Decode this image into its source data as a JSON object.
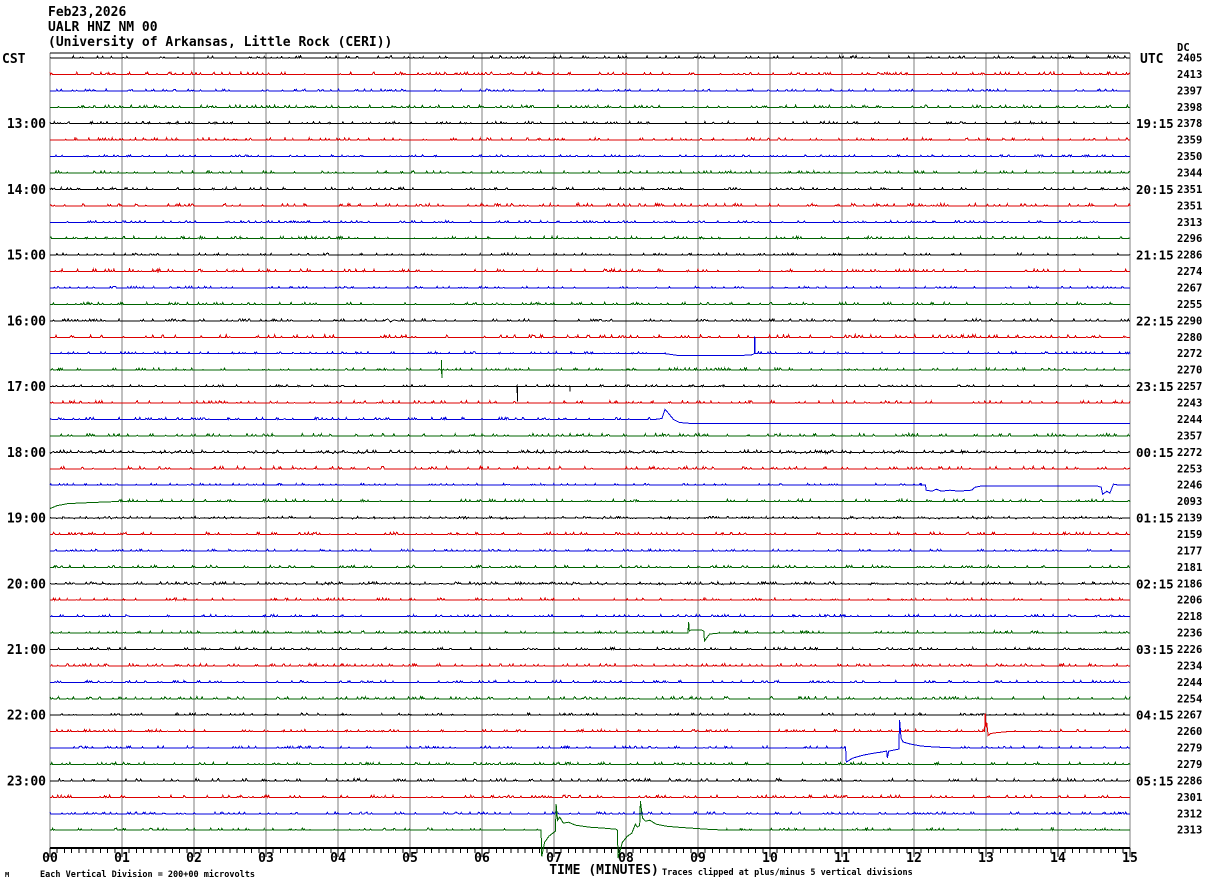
{
  "header": {
    "date": "Feb23,2026",
    "station": "UALR HNZ NM 00",
    "institution": "(University of Arkansas, Little Rock (CERI))"
  },
  "axes": {
    "left_tz": "CST",
    "right_tz": "UTC",
    "dc_header": "DC",
    "x_title": "TIME (MINUTES)",
    "x_ticks": [
      "00",
      "01",
      "02",
      "03",
      "04",
      "05",
      "06",
      "07",
      "08",
      "09",
      "10",
      "11",
      "12",
      "13",
      "14",
      "15"
    ]
  },
  "footer": {
    "scale_note": "Each Vertical Division =  200+00 microvolts",
    "clip_note": "Traces clipped at plus/minus 5 vertical divisions",
    "corner_mark": "M"
  },
  "palette": {
    "black": "#000000",
    "red": "#dd0000",
    "blue": "#0000dd",
    "green": "#006400",
    "grid": "#7f7f7f"
  },
  "chart_data": {
    "type": "line",
    "subtype": "helicorder-seismogram",
    "title": "UALR HNZ NM 00 (University of Arkansas, Little Rock (CERI)) Feb23,2026",
    "xlabel": "TIME (MINUTES)",
    "x_range_minutes": [
      0,
      15
    ],
    "minutes_per_line": 15,
    "grid": "vertical-only",
    "trace_color_cycle": [
      "black",
      "red",
      "blue",
      "green"
    ],
    "traces": [
      {
        "cst": "",
        "utc": "",
        "dc": "2405",
        "color": "black",
        "noise": 1.0,
        "events": []
      },
      {
        "cst": "",
        "utc": "",
        "dc": "2413",
        "color": "red",
        "noise": 1.0,
        "events": []
      },
      {
        "cst": "",
        "utc": "",
        "dc": "2397",
        "color": "blue",
        "noise": 0.7,
        "events": []
      },
      {
        "cst": "",
        "utc": "",
        "dc": "2398",
        "color": "green",
        "noise": 0.9,
        "events": []
      },
      {
        "cst": "13:00",
        "utc": "19:15",
        "dc": "2378",
        "color": "black",
        "noise": 0.9,
        "events": []
      },
      {
        "cst": "",
        "utc": "",
        "dc": "2359",
        "color": "red",
        "noise": 1.0,
        "events": []
      },
      {
        "cst": "",
        "utc": "",
        "dc": "2350",
        "color": "blue",
        "noise": 0.6,
        "events": []
      },
      {
        "cst": "",
        "utc": "",
        "dc": "2344",
        "color": "green",
        "noise": 0.9,
        "events": []
      },
      {
        "cst": "14:00",
        "utc": "20:15",
        "dc": "2351",
        "color": "black",
        "noise": 0.8,
        "events": []
      },
      {
        "cst": "",
        "utc": "",
        "dc": "2351",
        "color": "red",
        "noise": 1.0,
        "events": []
      },
      {
        "cst": "",
        "utc": "",
        "dc": "2313",
        "color": "blue",
        "noise": 0.6,
        "events": []
      },
      {
        "cst": "",
        "utc": "",
        "dc": "2296",
        "color": "green",
        "noise": 1.0,
        "events": []
      },
      {
        "cst": "15:00",
        "utc": "21:15",
        "dc": "2286",
        "color": "black",
        "noise": 0.8,
        "events": []
      },
      {
        "cst": "",
        "utc": "",
        "dc": "2274",
        "color": "red",
        "noise": 1.1,
        "events": []
      },
      {
        "cst": "",
        "utc": "",
        "dc": "2267",
        "color": "blue",
        "noise": 0.6,
        "events": []
      },
      {
        "cst": "",
        "utc": "",
        "dc": "2255",
        "color": "green",
        "noise": 0.9,
        "events": []
      },
      {
        "cst": "16:00",
        "utc": "22:15",
        "dc": "2290",
        "color": "black",
        "noise": 0.8,
        "events": [
          {
            "type": "path",
            "pts": [
              [
                4.64,
                0
              ],
              [
                4.69,
                2
              ],
              [
                4.73,
                -1
              ],
              [
                4.78,
                1
              ],
              [
                4.83,
                0
              ]
            ]
          }
        ]
      },
      {
        "cst": "",
        "utc": "",
        "dc": "2280",
        "color": "red",
        "noise": 1.1,
        "events": []
      },
      {
        "cst": "",
        "utc": "",
        "dc": "2272",
        "color": "blue",
        "noise": 0.9,
        "events": [
          {
            "type": "path",
            "pts": [
              [
                8.55,
                0
              ],
              [
                8.75,
                -2
              ],
              [
                9.55,
                -2
              ],
              [
                9.75,
                -1
              ],
              [
                9.78,
                0
              ]
            ]
          },
          {
            "type": "spike",
            "m": 9.79,
            "up": 17,
            "down": 0
          }
        ]
      },
      {
        "cst": "",
        "utc": "",
        "dc": "2270",
        "color": "green",
        "noise": 0.9,
        "events": [
          {
            "type": "spike",
            "m": 5.44,
            "up": 10,
            "down": 8
          }
        ]
      },
      {
        "cst": "17:00",
        "utc": "23:15",
        "dc": "2257",
        "color": "black",
        "noise": 0.7,
        "events": [
          {
            "type": "spike",
            "m": 6.49,
            "up": 0,
            "down": 15
          },
          {
            "type": "spike",
            "m": 7.22,
            "up": 0,
            "down": 5
          }
        ]
      },
      {
        "cst": "",
        "utc": "",
        "dc": "2243",
        "color": "red",
        "noise": 1.0,
        "events": []
      },
      {
        "cst": "",
        "utc": "",
        "dc": "2244",
        "color": "blue",
        "noise": 0.8,
        "events": [
          {
            "type": "path",
            "pts": [
              [
                8.4,
                0
              ],
              [
                8.5,
                1
              ],
              [
                8.54,
                10
              ],
              [
                8.58,
                7
              ],
              [
                8.66,
                0
              ],
              [
                8.74,
                -3
              ],
              [
                8.9,
                -4
              ],
              [
                15,
                -4
              ]
            ]
          }
        ]
      },
      {
        "cst": "",
        "utc": "",
        "dc": "2357",
        "color": "green",
        "noise": 1.0,
        "events": []
      },
      {
        "cst": "18:00",
        "utc": "00:15",
        "dc": "2272",
        "color": "black",
        "noise": 1.7,
        "events": []
      },
      {
        "cst": "",
        "utc": "",
        "dc": "2253",
        "color": "red",
        "noise": 1.0,
        "events": []
      },
      {
        "cst": "",
        "utc": "",
        "dc": "2246",
        "color": "blue",
        "noise": 0.7,
        "events": [
          {
            "type": "path",
            "pts": [
              [
                12.1,
                0
              ],
              [
                12.16,
                0
              ],
              [
                12.17,
                -5
              ],
              [
                12.25,
                -6
              ],
              [
                12.31,
                -4
              ],
              [
                12.38,
                -6
              ],
              [
                12.5,
                -5
              ],
              [
                12.62,
                -6
              ],
              [
                12.8,
                -5
              ],
              [
                12.85,
                -2
              ],
              [
                12.92,
                -1
              ],
              [
                14.55,
                -1
              ],
              [
                14.6,
                -2
              ],
              [
                14.62,
                -9
              ],
              [
                14.68,
                -6
              ],
              [
                14.72,
                -8
              ],
              [
                14.77,
                1
              ],
              [
                14.85,
                0
              ],
              [
                15,
                0
              ]
            ]
          }
        ]
      },
      {
        "cst": "",
        "utc": "",
        "dc": "2093",
        "color": "green",
        "noise": 1.0,
        "events": [
          {
            "type": "path",
            "pts": [
              [
                0,
                -7
              ],
              [
                0.1,
                -4
              ],
              [
                0.25,
                -2
              ],
              [
                0.55,
                -1
              ],
              [
                0.9,
                0
              ]
            ]
          }
        ]
      },
      {
        "cst": "19:00",
        "utc": "01:15",
        "dc": "2139",
        "color": "black",
        "noise": 1.3,
        "events": []
      },
      {
        "cst": "",
        "utc": "",
        "dc": "2159",
        "color": "red",
        "noise": 0.9,
        "events": []
      },
      {
        "cst": "",
        "utc": "",
        "dc": "2177",
        "color": "blue",
        "noise": 0.6,
        "events": []
      },
      {
        "cst": "",
        "utc": "",
        "dc": "2181",
        "color": "green",
        "noise": 0.8,
        "events": []
      },
      {
        "cst": "20:00",
        "utc": "02:15",
        "dc": "2186",
        "color": "black",
        "noise": 1.5,
        "events": []
      },
      {
        "cst": "",
        "utc": "",
        "dc": "2206",
        "color": "red",
        "noise": 0.9,
        "events": []
      },
      {
        "cst": "",
        "utc": "",
        "dc": "2218",
        "color": "blue",
        "noise": 0.8,
        "events": []
      },
      {
        "cst": "",
        "utc": "",
        "dc": "2236",
        "color": "green",
        "noise": 0.9,
        "events": [
          {
            "type": "path",
            "pts": [
              [
                8.84,
                0
              ],
              [
                8.86,
                0
              ],
              [
                8.87,
                11
              ],
              [
                8.88,
                2
              ],
              [
                8.9,
                3
              ],
              [
                9.05,
                3
              ],
              [
                9.08,
                2
              ],
              [
                9.09,
                -8
              ],
              [
                9.12,
                -5
              ],
              [
                9.16,
                -1
              ],
              [
                9.3,
                0
              ]
            ]
          }
        ]
      },
      {
        "cst": "21:00",
        "utc": "03:15",
        "dc": "2226",
        "color": "black",
        "noise": 0.8,
        "events": []
      },
      {
        "cst": "",
        "utc": "",
        "dc": "2234",
        "color": "red",
        "noise": 0.9,
        "events": []
      },
      {
        "cst": "",
        "utc": "",
        "dc": "2244",
        "color": "blue",
        "noise": 0.7,
        "events": []
      },
      {
        "cst": "",
        "utc": "",
        "dc": "2254",
        "color": "green",
        "noise": 0.9,
        "events": []
      },
      {
        "cst": "22:00",
        "utc": "04:15",
        "dc": "2267",
        "color": "black",
        "noise": 0.8,
        "events": []
      },
      {
        "cst": "",
        "utc": "",
        "dc": "2260",
        "color": "red",
        "noise": 0.9,
        "events": [
          {
            "type": "path",
            "pts": [
              [
                12.95,
                0
              ],
              [
                12.98,
                0
              ],
              [
                12.99,
                18
              ],
              [
                13.0,
                4
              ],
              [
                13.01,
                9
              ],
              [
                13.03,
                -4
              ],
              [
                13.06,
                -2
              ],
              [
                13.15,
                -1
              ],
              [
                13.3,
                0
              ]
            ]
          }
        ]
      },
      {
        "cst": "",
        "utc": "",
        "dc": "2279",
        "color": "blue",
        "noise": 0.8,
        "events": [
          {
            "type": "path",
            "pts": [
              [
                11.0,
                0
              ],
              [
                11.05,
                0
              ],
              [
                11.06,
                -14
              ],
              [
                11.15,
                -10
              ],
              [
                11.3,
                -7
              ],
              [
                11.45,
                -5
              ],
              [
                11.55,
                -4
              ],
              [
                11.62,
                -3
              ],
              [
                11.63,
                -10
              ],
              [
                11.65,
                -3
              ],
              [
                11.72,
                -2
              ],
              [
                11.79,
                -1
              ],
              [
                11.8,
                28
              ],
              [
                11.82,
                10
              ],
              [
                11.85,
                6
              ],
              [
                11.95,
                4
              ],
              [
                12.1,
                2
              ],
              [
                12.3,
                1
              ],
              [
                12.6,
                0
              ]
            ]
          }
        ]
      },
      {
        "cst": "",
        "utc": "",
        "dc": "2279",
        "color": "green",
        "noise": 0.9,
        "events": []
      },
      {
        "cst": "23:00",
        "utc": "05:15",
        "dc": "2286",
        "color": "black",
        "noise": 1.0,
        "events": []
      },
      {
        "cst": "",
        "utc": "",
        "dc": "2301",
        "color": "red",
        "noise": 0.9,
        "events": []
      },
      {
        "cst": "",
        "utc": "",
        "dc": "2312",
        "color": "blue",
        "noise": 0.7,
        "events": []
      },
      {
        "cst": "",
        "utc": "",
        "dc": "2313",
        "color": "green",
        "noise": 0.9,
        "events": [
          {
            "type": "path",
            "pts": [
              [
                6.78,
                0
              ],
              [
                6.82,
                0
              ],
              [
                6.83,
                -26
              ],
              [
                6.87,
                -12
              ],
              [
                6.93,
                -6
              ],
              [
                7.0,
                -2
              ],
              [
                7.02,
                -1
              ],
              [
                7.03,
                26
              ],
              [
                7.05,
                10
              ],
              [
                7.08,
                13
              ],
              [
                7.13,
                7
              ],
              [
                7.2,
                8
              ],
              [
                7.3,
                5
              ],
              [
                7.5,
                3
              ],
              [
                7.7,
                2
              ],
              [
                7.86,
                1
              ],
              [
                7.88,
                0
              ],
              [
                7.89,
                -28
              ],
              [
                7.95,
                -12
              ],
              [
                8.02,
                -6
              ],
              [
                8.08,
                -3
              ],
              [
                8.13,
                6
              ],
              [
                8.16,
                3
              ],
              [
                8.19,
                5
              ],
              [
                8.2,
                29
              ],
              [
                8.23,
                12
              ],
              [
                8.27,
                9
              ],
              [
                8.33,
                10
              ],
              [
                8.42,
                6
              ],
              [
                8.56,
                4
              ],
              [
                8.72,
                3
              ],
              [
                8.92,
                2
              ],
              [
                9.12,
                1
              ],
              [
                9.4,
                0
              ]
            ]
          }
        ]
      }
    ]
  }
}
